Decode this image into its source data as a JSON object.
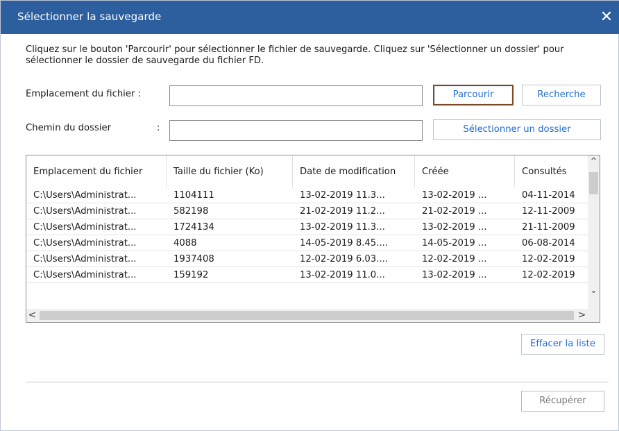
{
  "window": {
    "title": "Sélectionner la sauvegarde",
    "close_glyph": "✕"
  },
  "instructions": "Cliquez sur le bouton 'Parcourir' pour sélectionner le fichier de sauvegarde. Cliquez sur 'Sélectionner un dossier' pour sélectionner le dossier de sauvegarde du fichier FD.",
  "file_location": {
    "label": "Emplacement du fichier :",
    "value": "",
    "browse_label": "Parcourir",
    "search_label": "Recherche"
  },
  "folder_path": {
    "label": "Chemin du dossier",
    "colon": ":",
    "value": "",
    "select_folder_label": "Sélectionner un dossier"
  },
  "table": {
    "columns": [
      "Emplacement du fichier",
      "Taille du fichier (Ko)",
      "Date de modification",
      "Créée",
      "Consultés"
    ],
    "rows": [
      [
        "C:\\Users\\Administrat...",
        "1104111",
        "13-02-2019 11.3...",
        "13-02-2019 ...",
        "04-11-2014"
      ],
      [
        "C:\\Users\\Administrat...",
        "582198",
        "21-02-2019 11.2...",
        "21-02-2019 ...",
        "12-11-2009"
      ],
      [
        "C:\\Users\\Administrat...",
        "1724134",
        "13-02-2019 11.3...",
        "13-02-2019 ...",
        "21-11-2009"
      ],
      [
        "C:\\Users\\Administrat...",
        "4088",
        "14-05-2019 8.45....",
        "14-05-2019 ...",
        "06-08-2014"
      ],
      [
        "C:\\Users\\Administrat...",
        "1937408",
        "12-02-2019 6.03....",
        "12-02-2019 ...",
        "12-02-2019"
      ],
      [
        "C:\\Users\\Administrat...",
        "159192",
        "13-02-2019 11.0...",
        "13-02-2019 ...",
        "12-02-2019"
      ]
    ],
    "scroll": {
      "up_glyph": "^",
      "down_glyph": "⌄",
      "left_glyph": "<",
      "right_glyph": ">"
    }
  },
  "clear_list_label": "Effacer la liste",
  "recover_label": "Récupérer"
}
